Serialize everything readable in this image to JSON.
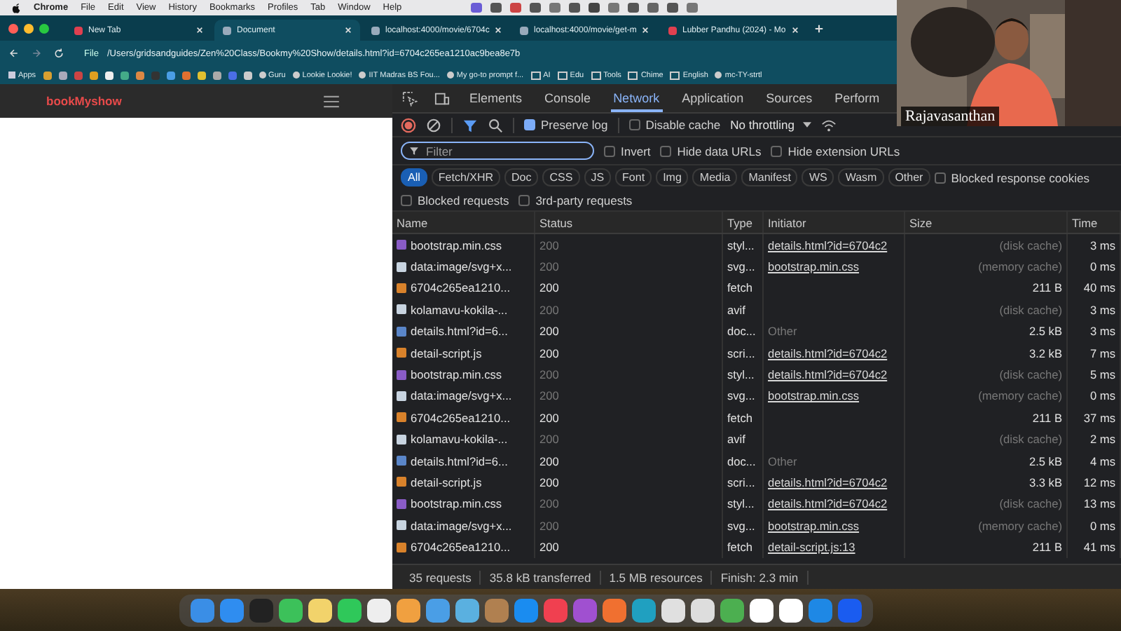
{
  "menu_bar": {
    "items": [
      "Chrome",
      "File",
      "Edit",
      "View",
      "History",
      "Bookmarks",
      "Profiles",
      "Tab",
      "Window",
      "Help"
    ]
  },
  "browser": {
    "tabs": [
      {
        "title": "New Tab",
        "selected": false
      },
      {
        "title": "Document",
        "selected": true
      },
      {
        "title": "localhost:4000/movie/6704c",
        "selected": false
      },
      {
        "title": "localhost:4000/movie/get-m",
        "selected": false
      },
      {
        "title": "Lubber Pandhu (2024) - Mo",
        "selected": false
      }
    ],
    "address": {
      "scheme": "File",
      "url": "/Users/gridsandguides/Zen%20Class/Bookmy%20Show/details.html?id=6704c265ea1210ac9bea8e7b"
    },
    "bookmarks": [
      {
        "label": "Apps",
        "kind": "apps"
      },
      {
        "label": "Guru",
        "kind": "site"
      },
      {
        "label": "Lookie Lookie!",
        "kind": "site"
      },
      {
        "label": "IIT Madras BS Fou...",
        "kind": "site"
      },
      {
        "label": "My go-to prompt f...",
        "kind": "site"
      },
      {
        "label": "AI",
        "kind": "folder"
      },
      {
        "label": "Edu",
        "kind": "folder"
      },
      {
        "label": "Tools",
        "kind": "folder"
      },
      {
        "label": "Chime",
        "kind": "folder"
      },
      {
        "label": "English",
        "kind": "folder"
      },
      {
        "label": "mc-TY-strtl",
        "kind": "site"
      }
    ]
  },
  "page": {
    "brand": "bookMyshow"
  },
  "devtools": {
    "tabs": [
      {
        "label": "Elements",
        "selected": false
      },
      {
        "label": "Console",
        "selected": false
      },
      {
        "label": "Network",
        "selected": true
      },
      {
        "label": "Application",
        "selected": false
      },
      {
        "label": "Sources",
        "selected": false
      },
      {
        "label": "Perform",
        "selected": false
      }
    ],
    "preserve_log": {
      "label": "Preserve log",
      "checked": true
    },
    "disable_cache": {
      "label": "Disable cache",
      "checked": false
    },
    "throttling": "No throttling",
    "filter": {
      "placeholder": "Filter"
    },
    "filter_options": [
      {
        "label": "Invert",
        "checked": false
      },
      {
        "label": "Hide data URLs",
        "checked": false
      },
      {
        "label": "Hide extension URLs",
        "checked": false
      }
    ],
    "type_filters": [
      {
        "label": "All",
        "selected": true
      },
      {
        "label": "Fetch/XHR",
        "selected": false
      },
      {
        "label": "Doc",
        "selected": false
      },
      {
        "label": "CSS",
        "selected": false
      },
      {
        "label": "JS",
        "selected": false
      },
      {
        "label": "Font",
        "selected": false
      },
      {
        "label": "Img",
        "selected": false
      },
      {
        "label": "Media",
        "selected": false
      },
      {
        "label": "Manifest",
        "selected": false
      },
      {
        "label": "WS",
        "selected": false
      },
      {
        "label": "Wasm",
        "selected": false
      },
      {
        "label": "Other",
        "selected": false
      }
    ],
    "blocked_cookies": {
      "label": "Blocked response cookies",
      "checked": false
    },
    "extra_options": [
      {
        "label": "Blocked requests",
        "checked": false
      },
      {
        "label": "3rd-party requests",
        "checked": false
      }
    ],
    "columns": [
      "Name",
      "Status",
      "Type",
      "Initiator",
      "Size",
      "Time"
    ],
    "rows": [
      {
        "name": "bootstrap.min.css",
        "kind": "css",
        "status": "200",
        "cached": true,
        "type": "styl...",
        "initiator": "details.html?id=6704c2",
        "initiator_link": true,
        "size": "(disk cache)",
        "time": "3 ms"
      },
      {
        "name": "data:image/svg+x...",
        "status": "200",
        "cached": true,
        "type": "svg...",
        "initiator": "bootstrap.min.css",
        "initiator_link": true,
        "size": "(memory cache)",
        "time": "0 ms"
      },
      {
        "name": "6704c265ea1210...",
        "kind": "fetch",
        "status": "200",
        "cached": false,
        "type": "fetch",
        "size": "211 B",
        "time": "40 ms"
      },
      {
        "name": "kolamavu-kokila-...",
        "status": "200",
        "cached": true,
        "type": "avif",
        "size": "(disk cache)",
        "time": "3 ms"
      },
      {
        "name": "details.html?id=6...",
        "kind": "doc",
        "status": "200",
        "cached": false,
        "type": "doc...",
        "initiator": "Other",
        "initiator_link": false,
        "size": "2.5 kB",
        "time": "3 ms"
      },
      {
        "name": "detail-script.js",
        "kind": "script",
        "status": "200",
        "cached": false,
        "type": "scri...",
        "initiator": "details.html?id=6704c2",
        "initiator_link": true,
        "size": "3.2 kB",
        "time": "7 ms"
      },
      {
        "name": "bootstrap.min.css",
        "kind": "css",
        "status": "200",
        "cached": true,
        "type": "styl...",
        "initiator": "details.html?id=6704c2",
        "initiator_link": true,
        "size": "(disk cache)",
        "time": "5 ms"
      },
      {
        "name": "data:image/svg+x...",
        "status": "200",
        "cached": true,
        "type": "svg...",
        "initiator": "bootstrap.min.css",
        "initiator_link": true,
        "size": "(memory cache)",
        "time": "0 ms"
      },
      {
        "name": "6704c265ea1210...",
        "kind": "fetch",
        "status": "200",
        "cached": false,
        "type": "fetch",
        "size": "211 B",
        "time": "37 ms"
      },
      {
        "name": "kolamavu-kokila-...",
        "status": "200",
        "cached": true,
        "type": "avif",
        "size": "(disk cache)",
        "time": "2 ms"
      },
      {
        "name": "details.html?id=6...",
        "kind": "doc",
        "status": "200",
        "cached": false,
        "type": "doc...",
        "initiator": "Other",
        "initiator_link": false,
        "size": "2.5 kB",
        "time": "4 ms"
      },
      {
        "name": "detail-script.js",
        "kind": "script",
        "status": "200",
        "cached": false,
        "type": "scri...",
        "initiator": "details.html?id=6704c2",
        "initiator_link": true,
        "size": "3.3 kB",
        "time": "12 ms"
      },
      {
        "name": "bootstrap.min.css",
        "kind": "css",
        "status": "200",
        "cached": true,
        "type": "styl...",
        "initiator": "details.html?id=6704c2",
        "initiator_link": true,
        "size": "(disk cache)",
        "time": "13 ms"
      },
      {
        "name": "data:image/svg+x...",
        "status": "200",
        "cached": true,
        "type": "svg...",
        "initiator": "bootstrap.min.css",
        "initiator_link": true,
        "size": "(memory cache)",
        "time": "0 ms"
      },
      {
        "name": "6704c265ea1210...",
        "kind": "fetch",
        "status": "200",
        "cached": false,
        "type": "fetch",
        "initiator": "detail-script.js:13",
        "initiator_link": true,
        "size": "211 B",
        "time": "41 ms"
      }
    ],
    "summary": [
      "35 requests",
      "35.8 kB transferred",
      "1.5 MB resources",
      "Finish: 2.3 min"
    ]
  },
  "video": {
    "kind": "picture",
    "participant": "Rajavasanthan"
  }
}
